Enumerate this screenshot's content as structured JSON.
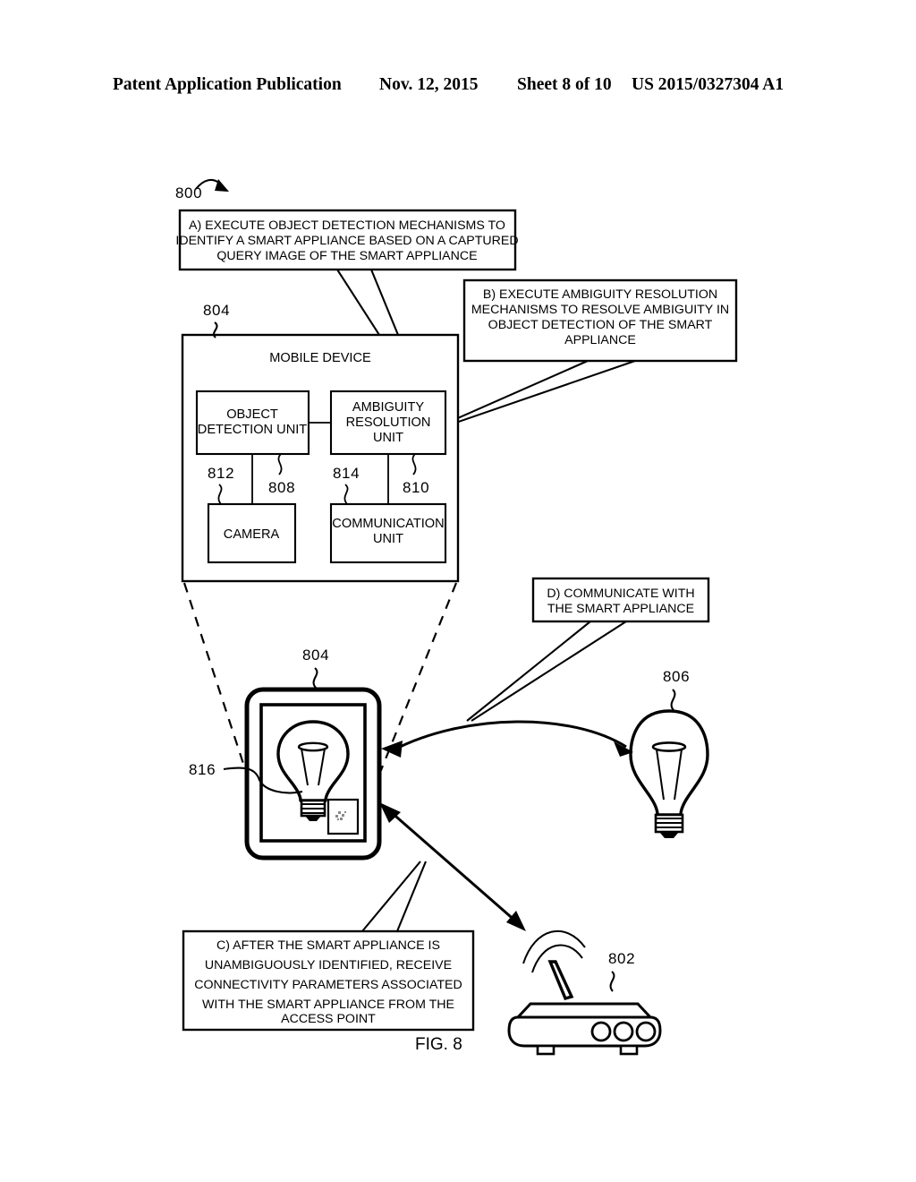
{
  "header": {
    "publication": "Patent Application Publication",
    "date": "Nov. 12, 2015",
    "sheet": "Sheet 8 of 10",
    "patent_number": "US 2015/0327304 A1"
  },
  "figure": {
    "caption": "FIG. 8",
    "figure_ref": "800",
    "callouts": {
      "a": {
        "line1": "A) EXECUTE OBJECT DETECTION MECHANISMS TO",
        "line2": "IDENTIFY A SMART APPLIANCE BASED ON A CAPTURED",
        "line3": "QUERY IMAGE OF THE SMART APPLIANCE"
      },
      "b": {
        "line1": "B) EXECUTE AMBIGUITY RESOLUTION",
        "line2": "MECHANISMS TO RESOLVE AMBIGUITY IN",
        "line3": "OBJECT DETECTION OF THE SMART",
        "line4": "APPLIANCE"
      },
      "c": {
        "line1": "C) AFTER THE SMART APPLIANCE IS",
        "line2": "UNAMBIGUOUSLY IDENTIFIED, RECEIVE",
        "line3": "CONNECTIVITY PARAMETERS ASSOCIATED",
        "line4": "WITH THE SMART APPLIANCE FROM THE",
        "line5": "ACCESS POINT"
      },
      "d": {
        "line1": "D) COMMUNICATE WITH",
        "line2": "THE SMART APPLIANCE"
      }
    },
    "mobile_device": {
      "title": "MOBILE DEVICE",
      "ref": "804",
      "blocks": [
        {
          "label_line1": "OBJECT",
          "label_line2": "DETECTION UNIT",
          "ref": "808"
        },
        {
          "label_line1": "AMBIGUITY",
          "label_line2": "RESOLUTION",
          "label_line3": "UNIT",
          "ref": "810"
        },
        {
          "label_line1": "CAMERA",
          "ref": "812"
        },
        {
          "label_line1": "COMMUNICATION",
          "label_line2": "UNIT",
          "ref": "814"
        }
      ]
    },
    "tablet": {
      "ref": "804",
      "bulb_image_ref": "816"
    },
    "smart_bulb": {
      "ref": "806"
    },
    "access_point": {
      "ref": "802"
    }
  }
}
